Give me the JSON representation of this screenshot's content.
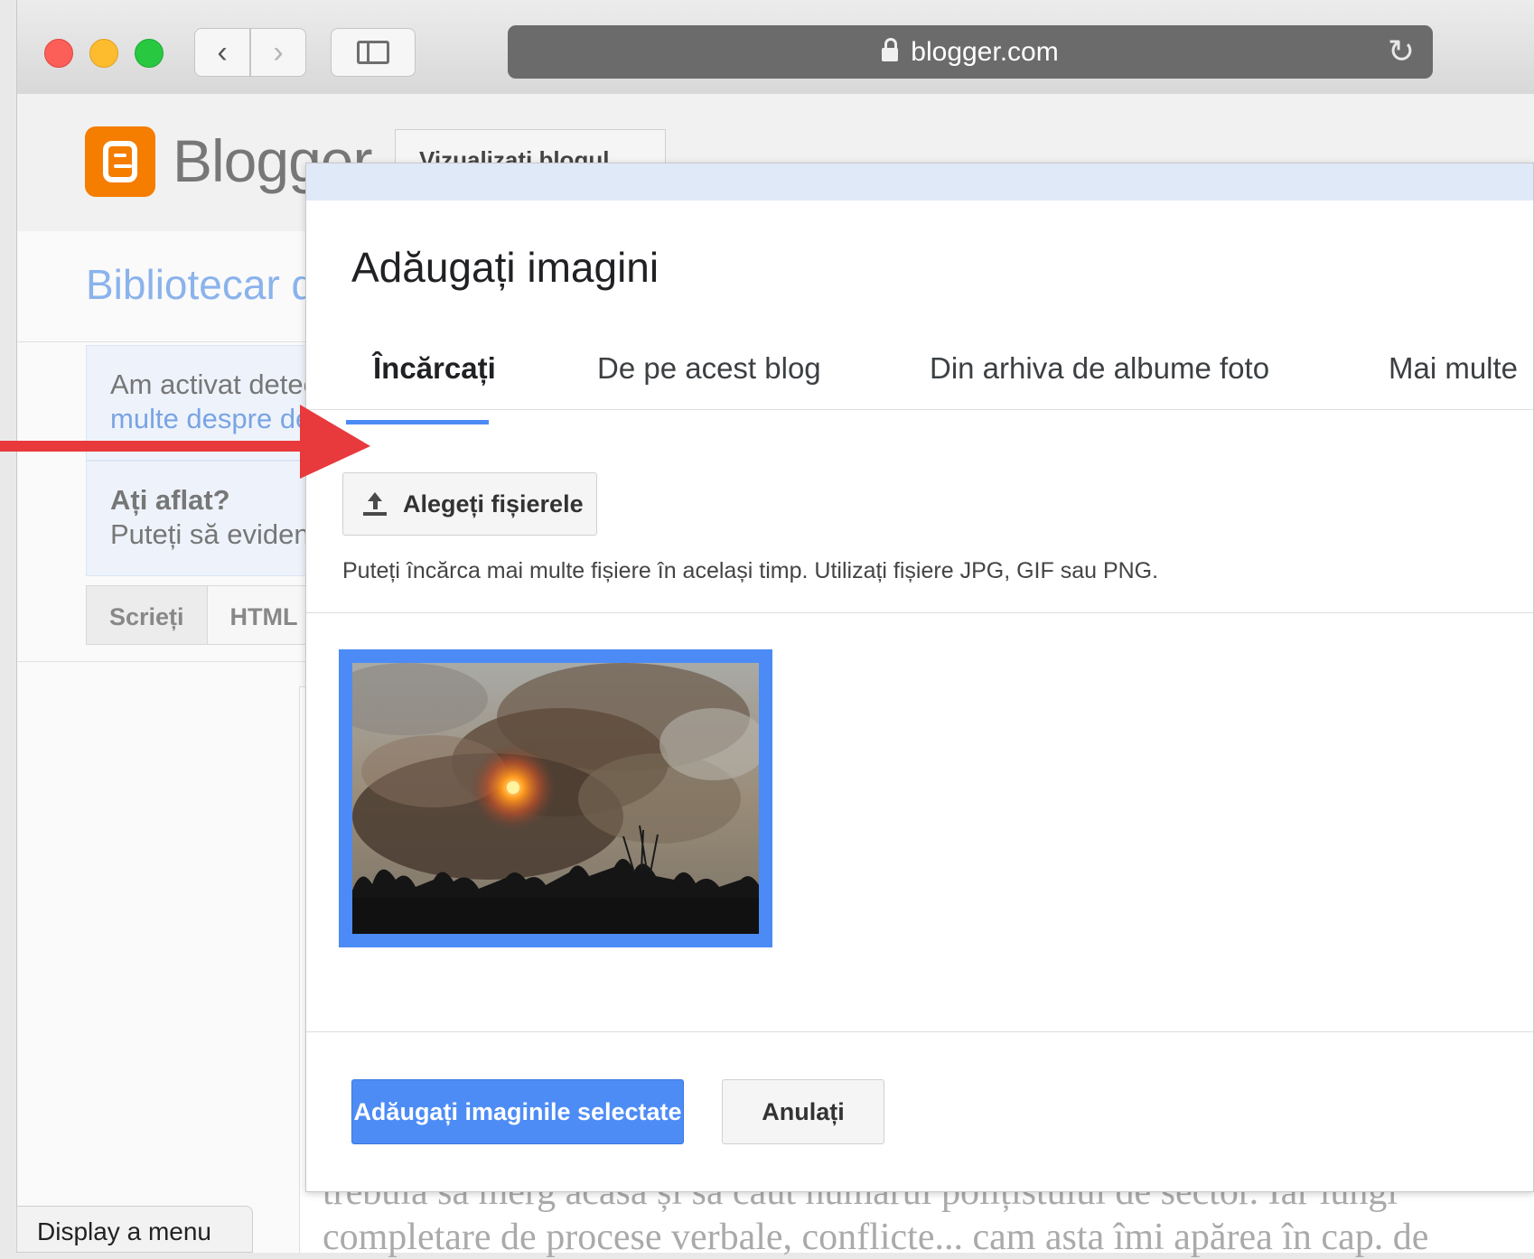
{
  "browser": {
    "url": "blogger.com"
  },
  "blogger": {
    "wordmark": "Blogger",
    "view_blog_button": "Vizualizați blogul",
    "blog_title": "Bibliotecar de",
    "notice_line1": "Am activat detectarea",
    "notice_line2": "multe despre detectare",
    "tip_title": "Ați aflat?",
    "tip_text": "Puteți să evidențiați",
    "edit_tabs": [
      "Scrieți",
      "HTML"
    ],
    "body_line1": "trebuia să merg acasă și să caut numărul polițistului de sector. Iar lungi",
    "body_line2": "completare de procese verbale, conflicte... cam asta îmi apărea în cap. de"
  },
  "dialog": {
    "title": "Adăugați imagini",
    "tabs": [
      "Încărcați",
      "De pe acest blog",
      "Din arhiva de albume foto",
      "Mai multe"
    ],
    "active_tab": 0,
    "choose_files_label": "Alegeți fișierele",
    "help_text": "Puteți încărca mai multe fișiere în același timp. Utilizați fișiere JPG, GIF sau PNG.",
    "add_selected_label": "Adăugați imaginile selectate",
    "cancel_label": "Anulați"
  },
  "status_bar": {
    "text": "Display a menu"
  },
  "colors": {
    "accent": "#4c8bf5",
    "arrow": "#e8393c",
    "blogger_orange": "#f57d00",
    "link": "#8ab3ec"
  },
  "icons": [
    "lock-icon",
    "reload-icon",
    "back-icon",
    "forward-icon",
    "sidebar-icon",
    "blogger-logo-icon",
    "upload-icon",
    "red-arrow-annotation"
  ]
}
